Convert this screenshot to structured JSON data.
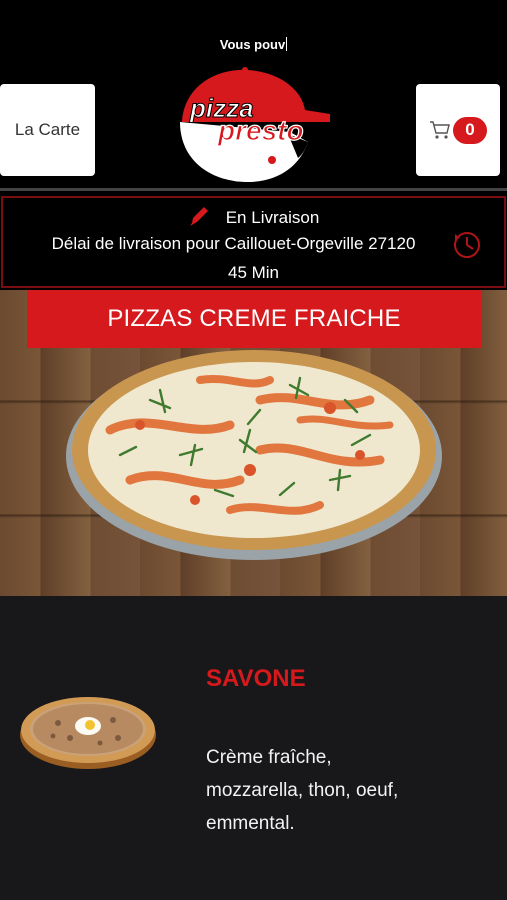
{
  "header": {
    "ticker_text": "Vous pouv",
    "menu_button_label": "La Carte",
    "cart_count": "0",
    "logo_line1": "pizza",
    "logo_line2": "presto"
  },
  "delivery": {
    "mode": "En Livraison",
    "delay_text": "Délai de livraison pour Caillouet-Orgeville 27120",
    "duration": "45 Min"
  },
  "category": {
    "title": "PIZZAS CREME FRAICHE"
  },
  "product": {
    "name": "SAVONE",
    "description": "Crème fraîche, mozzarella, thon, oeuf, emmental."
  },
  "colors": {
    "brand_red": "#d5191d",
    "background": "#000000",
    "product_bg": "#18181b"
  },
  "icons": [
    "pencil-icon",
    "clock-icon",
    "cart-icon"
  ]
}
